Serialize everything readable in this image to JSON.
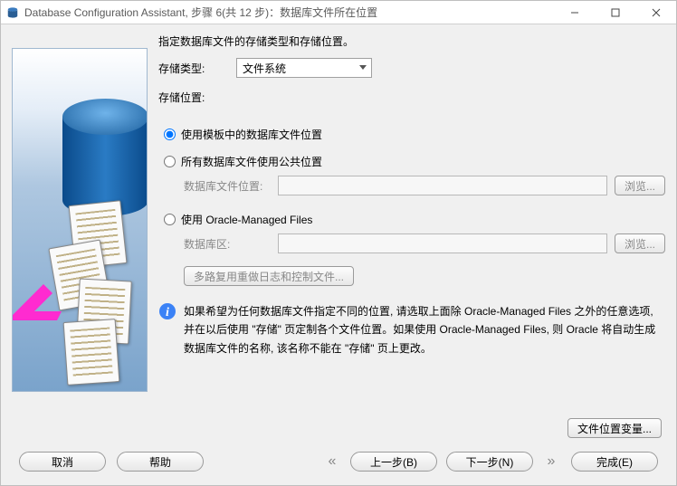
{
  "window": {
    "title": "Database Configuration Assistant, 步骤 6(共 12 步)：数据库文件所在位置"
  },
  "header": {
    "instruction": "指定数据库文件的存储类型和存储位置。",
    "storage_type_label": "存储类型:",
    "storage_type_value": "文件系统",
    "storage_location_label": "存储位置:"
  },
  "options": {
    "opt_template": "使用模板中的数据库文件位置",
    "opt_common": "所有数据库文件使用公共位置",
    "db_file_loc_label": "数据库文件位置:",
    "db_file_loc_value": "",
    "browse1": "浏览...",
    "opt_omf": "使用 Oracle-Managed Files",
    "db_area_label": "数据库区:",
    "db_area_value": "",
    "browse2": "浏览...",
    "multiplex": "多路复用重做日志和控制文件..."
  },
  "info": {
    "text": "如果希望为任何数据库文件指定不同的位置, 请选取上面除 Oracle-Managed Files 之外的任意选项, 并在以后使用 \"存储\" 页定制各个文件位置。如果使用 Oracle-Managed Files, 则 Oracle 将自动生成数据库文件的名称, 该名称不能在 \"存储\" 页上更改。"
  },
  "buttons": {
    "file_loc_vars": "文件位置变量...",
    "cancel": "取消",
    "help": "帮助",
    "back": "上一步(B)",
    "next": "下一步(N)",
    "finish": "完成(E)"
  }
}
